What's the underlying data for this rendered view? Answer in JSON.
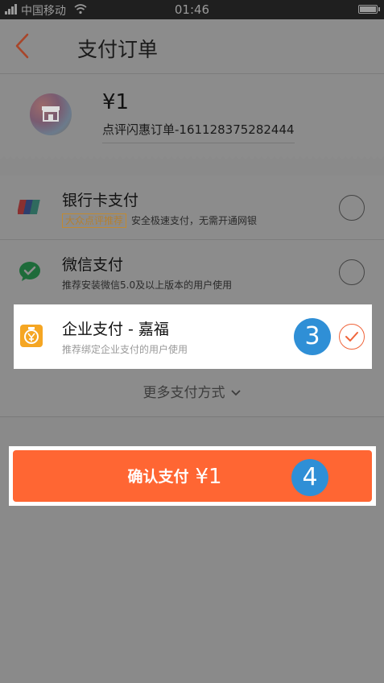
{
  "status_bar": {
    "carrier": "中国移动",
    "time": "01:46"
  },
  "header": {
    "title": "支付订单",
    "back_icon": "chevron-left-icon"
  },
  "order": {
    "amount": "¥1",
    "description": "点评闪惠订单-161128375282444"
  },
  "payment_methods": [
    {
      "name": "银行卡支付",
      "badge": "大众点评推荐",
      "desc": "安全极速支付，无需开通网银",
      "icon": "unionpay-icon",
      "selected": false
    },
    {
      "name": "微信支付",
      "desc": "推荐安装微信5.0及以上版本的用户使用",
      "icon": "wechat-pay-icon",
      "selected": false
    },
    {
      "name": "企业支付 - 嘉福",
      "desc": "推荐绑定企业支付的用户使用",
      "icon": "enterprise-pay-icon",
      "selected": true
    }
  ],
  "more_ways": "更多支付方式",
  "confirm": {
    "label": "确认支付",
    "price": "¥1"
  },
  "step_badges": [
    "3",
    "4"
  ],
  "colors": {
    "accent": "#ff6633",
    "badge_blue": "#2f8fd6",
    "overlay": "#8a8a8a"
  }
}
